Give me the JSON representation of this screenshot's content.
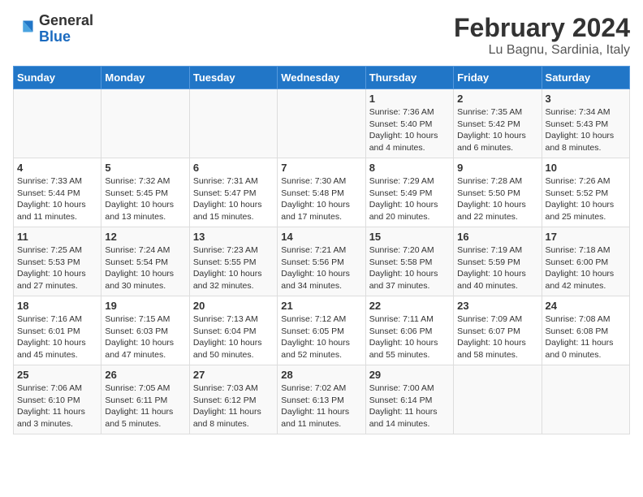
{
  "logo": {
    "line1": "General",
    "line2": "Blue"
  },
  "header": {
    "month": "February 2024",
    "location": "Lu Bagnu, Sardinia, Italy"
  },
  "weekdays": [
    "Sunday",
    "Monday",
    "Tuesday",
    "Wednesday",
    "Thursday",
    "Friday",
    "Saturday"
  ],
  "weeks": [
    [
      {
        "day": "",
        "info": ""
      },
      {
        "day": "",
        "info": ""
      },
      {
        "day": "",
        "info": ""
      },
      {
        "day": "",
        "info": ""
      },
      {
        "day": "1",
        "info": "Sunrise: 7:36 AM\nSunset: 5:40 PM\nDaylight: 10 hours\nand 4 minutes."
      },
      {
        "day": "2",
        "info": "Sunrise: 7:35 AM\nSunset: 5:42 PM\nDaylight: 10 hours\nand 6 minutes."
      },
      {
        "day": "3",
        "info": "Sunrise: 7:34 AM\nSunset: 5:43 PM\nDaylight: 10 hours\nand 8 minutes."
      }
    ],
    [
      {
        "day": "4",
        "info": "Sunrise: 7:33 AM\nSunset: 5:44 PM\nDaylight: 10 hours\nand 11 minutes."
      },
      {
        "day": "5",
        "info": "Sunrise: 7:32 AM\nSunset: 5:45 PM\nDaylight: 10 hours\nand 13 minutes."
      },
      {
        "day": "6",
        "info": "Sunrise: 7:31 AM\nSunset: 5:47 PM\nDaylight: 10 hours\nand 15 minutes."
      },
      {
        "day": "7",
        "info": "Sunrise: 7:30 AM\nSunset: 5:48 PM\nDaylight: 10 hours\nand 17 minutes."
      },
      {
        "day": "8",
        "info": "Sunrise: 7:29 AM\nSunset: 5:49 PM\nDaylight: 10 hours\nand 20 minutes."
      },
      {
        "day": "9",
        "info": "Sunrise: 7:28 AM\nSunset: 5:50 PM\nDaylight: 10 hours\nand 22 minutes."
      },
      {
        "day": "10",
        "info": "Sunrise: 7:26 AM\nSunset: 5:52 PM\nDaylight: 10 hours\nand 25 minutes."
      }
    ],
    [
      {
        "day": "11",
        "info": "Sunrise: 7:25 AM\nSunset: 5:53 PM\nDaylight: 10 hours\nand 27 minutes."
      },
      {
        "day": "12",
        "info": "Sunrise: 7:24 AM\nSunset: 5:54 PM\nDaylight: 10 hours\nand 30 minutes."
      },
      {
        "day": "13",
        "info": "Sunrise: 7:23 AM\nSunset: 5:55 PM\nDaylight: 10 hours\nand 32 minutes."
      },
      {
        "day": "14",
        "info": "Sunrise: 7:21 AM\nSunset: 5:56 PM\nDaylight: 10 hours\nand 34 minutes."
      },
      {
        "day": "15",
        "info": "Sunrise: 7:20 AM\nSunset: 5:58 PM\nDaylight: 10 hours\nand 37 minutes."
      },
      {
        "day": "16",
        "info": "Sunrise: 7:19 AM\nSunset: 5:59 PM\nDaylight: 10 hours\nand 40 minutes."
      },
      {
        "day": "17",
        "info": "Sunrise: 7:18 AM\nSunset: 6:00 PM\nDaylight: 10 hours\nand 42 minutes."
      }
    ],
    [
      {
        "day": "18",
        "info": "Sunrise: 7:16 AM\nSunset: 6:01 PM\nDaylight: 10 hours\nand 45 minutes."
      },
      {
        "day": "19",
        "info": "Sunrise: 7:15 AM\nSunset: 6:03 PM\nDaylight: 10 hours\nand 47 minutes."
      },
      {
        "day": "20",
        "info": "Sunrise: 7:13 AM\nSunset: 6:04 PM\nDaylight: 10 hours\nand 50 minutes."
      },
      {
        "day": "21",
        "info": "Sunrise: 7:12 AM\nSunset: 6:05 PM\nDaylight: 10 hours\nand 52 minutes."
      },
      {
        "day": "22",
        "info": "Sunrise: 7:11 AM\nSunset: 6:06 PM\nDaylight: 10 hours\nand 55 minutes."
      },
      {
        "day": "23",
        "info": "Sunrise: 7:09 AM\nSunset: 6:07 PM\nDaylight: 10 hours\nand 58 minutes."
      },
      {
        "day": "24",
        "info": "Sunrise: 7:08 AM\nSunset: 6:08 PM\nDaylight: 11 hours\nand 0 minutes."
      }
    ],
    [
      {
        "day": "25",
        "info": "Sunrise: 7:06 AM\nSunset: 6:10 PM\nDaylight: 11 hours\nand 3 minutes."
      },
      {
        "day": "26",
        "info": "Sunrise: 7:05 AM\nSunset: 6:11 PM\nDaylight: 11 hours\nand 5 minutes."
      },
      {
        "day": "27",
        "info": "Sunrise: 7:03 AM\nSunset: 6:12 PM\nDaylight: 11 hours\nand 8 minutes."
      },
      {
        "day": "28",
        "info": "Sunrise: 7:02 AM\nSunset: 6:13 PM\nDaylight: 11 hours\nand 11 minutes."
      },
      {
        "day": "29",
        "info": "Sunrise: 7:00 AM\nSunset: 6:14 PM\nDaylight: 11 hours\nand 14 minutes."
      },
      {
        "day": "",
        "info": ""
      },
      {
        "day": "",
        "info": ""
      }
    ]
  ]
}
